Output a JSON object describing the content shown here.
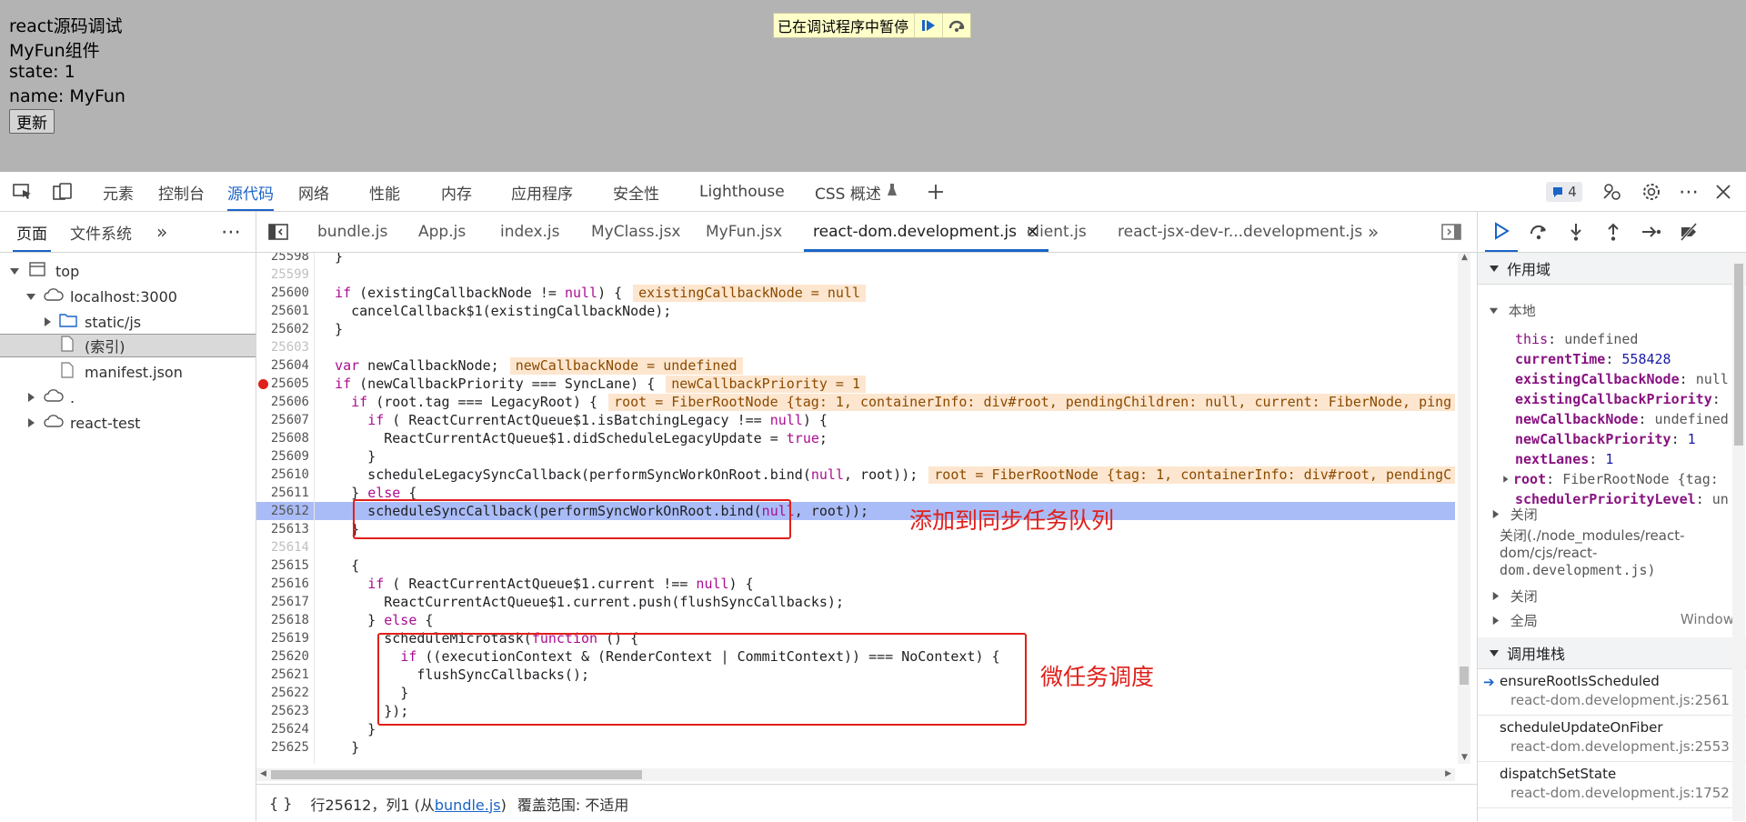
{
  "page": {
    "lines": [
      "react源码调试",
      "MyFun组件",
      "state: 1",
      "name: MyFun"
    ],
    "update_button": "更新",
    "paused_label": "已在调试程序中暂停"
  },
  "devtools_tabs": [
    "元素",
    "控制台",
    "源代码",
    "网络",
    "性能",
    "内存",
    "应用程序",
    "安全性",
    "Lighthouse",
    "CSS 概述"
  ],
  "issues_count": "4",
  "navigator": {
    "tabs": [
      "页面",
      "文件系统"
    ],
    "tree": [
      "top",
      "localhost:3000",
      "static/js",
      "(索引)",
      "manifest.json",
      ".",
      "react-test"
    ]
  },
  "file_tabs": [
    "bundle.js",
    "App.js",
    "index.js",
    "MyClass.jsx",
    "MyFun.jsx",
    "react-dom.development.js",
    "client.js",
    "react-jsx-dev-r...development.js"
  ],
  "code": [
    {
      "n": "25598",
      "t": "  }"
    },
    {
      "n": "25599",
      "t": ""
    },
    {
      "n": "25600",
      "t": "  if (existingCallbackNode != null) {",
      "inline": "existingCallbackNode = null"
    },
    {
      "n": "25601",
      "t": "    cancelCallback$1(existingCallbackNode);"
    },
    {
      "n": "25602",
      "t": "  }"
    },
    {
      "n": "25603",
      "t": ""
    },
    {
      "n": "25604",
      "t": "  var newCallbackNode;",
      "inline": "newCallbackNode = undefined"
    },
    {
      "n": "25605",
      "t": "  if (newCallbackPriority === SyncLane) {",
      "inline": "newCallbackPriority = 1"
    },
    {
      "n": "25606",
      "t": "    if (root.tag === LegacyRoot) {",
      "inline": "root = FiberRootNode {tag: 1, containerInfo: div#root, pendingChildren: null, current: FiberNode, ping"
    },
    {
      "n": "25607",
      "t": "      if ( ReactCurrentActQueue$1.isBatchingLegacy !== null) {"
    },
    {
      "n": "25608",
      "t": "        ReactCurrentActQueue$1.didScheduleLegacyUpdate = true;"
    },
    {
      "n": "25609",
      "t": "      }"
    },
    {
      "n": "25610",
      "t": "      scheduleLegacySyncCallback(performSyncWorkOnRoot.bind(null, root));",
      "inline": "root = FiberRootNode {tag: 1, containerInfo: div#root, pendingC"
    },
    {
      "n": "25611",
      "t": "    } else {"
    },
    {
      "n": "25612",
      "t": "      scheduleSyncCallback(performSyncWorkOnRoot.bind(null, root));"
    },
    {
      "n": "25613",
      "t": "    }"
    },
    {
      "n": "25614",
      "t": ""
    },
    {
      "n": "25615",
      "t": "    {"
    },
    {
      "n": "25616",
      "t": "      if ( ReactCurrentActQueue$1.current !== null) {"
    },
    {
      "n": "25617",
      "t": "        ReactCurrentActQueue$1.current.push(flushSyncCallbacks);"
    },
    {
      "n": "25618",
      "t": "      } else {"
    },
    {
      "n": "25619",
      "t": "        scheduleMicrotask(function () {"
    },
    {
      "n": "25620",
      "t": "          if ((executionContext & (RenderContext | CommitContext)) === NoContext) {"
    },
    {
      "n": "25621",
      "t": "            flushSyncCallbacks();"
    },
    {
      "n": "25622",
      "t": "          }"
    },
    {
      "n": "25623",
      "t": "        });"
    },
    {
      "n": "25624",
      "t": "      }"
    },
    {
      "n": "25625",
      "t": "    }"
    }
  ],
  "annotations": {
    "sync_queue": "添加到同步任务队列",
    "microtask": "微任务调度"
  },
  "status": {
    "braces": "{ }",
    "position_prefix": "行25612，列1 (从",
    "source_link": "bundle.js",
    "position_suffix": ")",
    "coverage": "覆盖范围: 不适用"
  },
  "debugger": {
    "scope_title": "作用域",
    "local_label": "本地",
    "locals": [
      {
        "k": "this",
        "v": "undefined",
        "bold": false
      },
      {
        "k": "currentTime",
        "v": "558428",
        "bold": true
      },
      {
        "k": "existingCallbackNode",
        "v": "null",
        "bold": true
      },
      {
        "k": "existingCallbackPriority",
        "v": "",
        "bold": true
      },
      {
        "k": "newCallbackNode",
        "v": "undefined",
        "bold": true
      },
      {
        "k": "newCallbackPriority",
        "v": "1",
        "bold": true
      },
      {
        "k": "nextLanes",
        "v": "1",
        "bold": true
      },
      {
        "k": "root",
        "v": "FiberRootNode {tag:",
        "bold": true
      },
      {
        "k": "schedulerPriorityLevel",
        "v": "un",
        "bold": true
      }
    ],
    "closure1": "关闭",
    "closure2": "关闭(./node_modules/react-dom/cjs/react-dom.development.js)",
    "closure2_lines": [
      "关闭(./node_modules/react-",
      "dom/cjs/react-",
      "dom.development.js)"
    ],
    "closure3": "关闭",
    "global_label": "全局",
    "global_value": "Window",
    "callstack_title": "调用堆栈",
    "frames": [
      {
        "fn": "ensureRootIsScheduled",
        "loc": "react-dom.development.js:2561"
      },
      {
        "fn": "scheduleUpdateOnFiber",
        "loc": "react-dom.development.js:2553"
      },
      {
        "fn": "dispatchSetState",
        "loc": "react-dom.development.js:1752"
      }
    ]
  },
  "colors": {
    "accent": "#1a64c8",
    "highlight": "#aabcf7",
    "annotation": "#e0201a",
    "breakpoint": "#e0201a"
  }
}
